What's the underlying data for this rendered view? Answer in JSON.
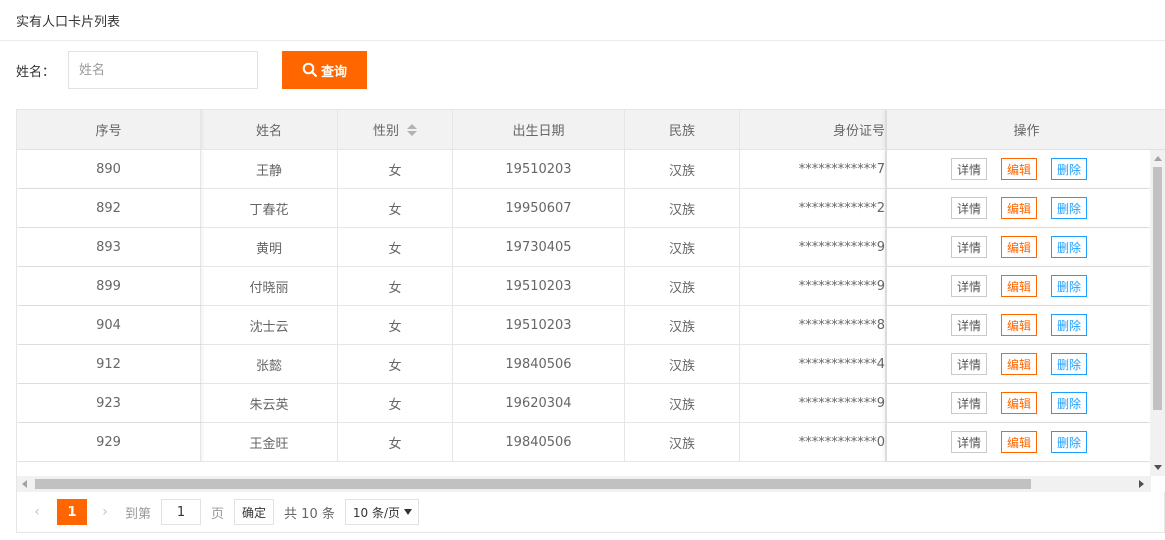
{
  "page": {
    "title": "实有人口卡片列表"
  },
  "search": {
    "label": "姓名：",
    "placeholder": "姓名",
    "value": "",
    "button_label": "查询"
  },
  "colors": {
    "accent": "#ff6600",
    "edit": "#ff6600",
    "delete": "#1e9fff"
  },
  "table": {
    "columns": [
      "序号",
      "姓名",
      "性别",
      "出生日期",
      "民族",
      "身份证号",
      "操作"
    ],
    "actions": {
      "detail": "详情",
      "edit": "编辑",
      "delete": "删除"
    },
    "rows": [
      {
        "id": "890",
        "name": "王静",
        "gender": "女",
        "birth": "19510203",
        "ethnicity": "汉族",
        "idcard": "************7"
      },
      {
        "id": "892",
        "name": "丁春花",
        "gender": "女",
        "birth": "19950607",
        "ethnicity": "汉族",
        "idcard": "************2"
      },
      {
        "id": "893",
        "name": "黄明",
        "gender": "女",
        "birth": "19730405",
        "ethnicity": "汉族",
        "idcard": "************9"
      },
      {
        "id": "899",
        "name": "付晓丽",
        "gender": "女",
        "birth": "19510203",
        "ethnicity": "汉族",
        "idcard": "************9"
      },
      {
        "id": "904",
        "name": "沈士云",
        "gender": "女",
        "birth": "19510203",
        "ethnicity": "汉族",
        "idcard": "************8"
      },
      {
        "id": "912",
        "name": "张懿",
        "gender": "女",
        "birth": "19840506",
        "ethnicity": "汉族",
        "idcard": "************4"
      },
      {
        "id": "923",
        "name": "朱云英",
        "gender": "女",
        "birth": "19620304",
        "ethnicity": "汉族",
        "idcard": "************9"
      },
      {
        "id": "929",
        "name": "王金旺",
        "gender": "女",
        "birth": "19840506",
        "ethnicity": "汉族",
        "idcard": "************0"
      }
    ]
  },
  "pagination": {
    "prev_icon": "chevron-left-icon",
    "next_icon": "chevron-right-icon",
    "current_page": "1",
    "goto_label": "到第",
    "goto_value": "1",
    "page_unit": "页",
    "confirm_label": "确定",
    "total_text": "共 10 条",
    "page_size": "10 条/页"
  }
}
